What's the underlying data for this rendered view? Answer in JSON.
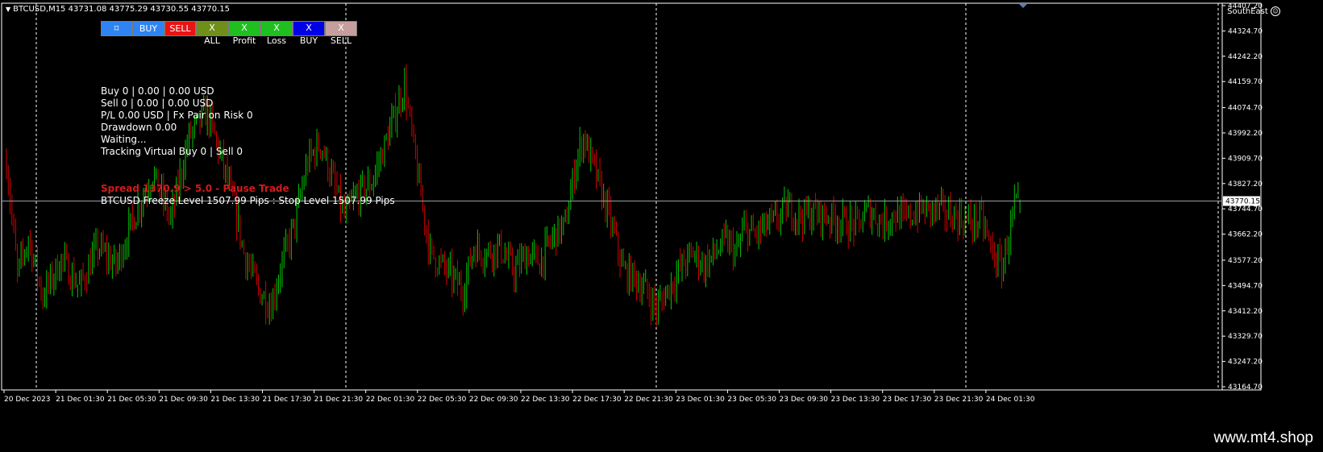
{
  "chart": {
    "symbol_header": "BTCUSD,M15  43731.08 43775.29 43730.55 43770.15",
    "corner_label": "SouthEast",
    "current_price_label": "43770.15",
    "current_price": 43770.15,
    "price_axis": {
      "min": 43164.7,
      "max": 44407.2,
      "labels": [
        "44407.20",
        "44324.70",
        "44242.20",
        "44159.70",
        "44074.70",
        "43992.20",
        "43909.70",
        "43827.20",
        "43744.70",
        "43662.20",
        "43577.20",
        "43494.70",
        "43412.20",
        "43329.70",
        "43247.20",
        "43164.70"
      ]
    },
    "time_axis": {
      "labels": [
        "20 Dec 2023",
        "21 Dec 01:30",
        "21 Dec 05:30",
        "21 Dec 09:30",
        "21 Dec 13:30",
        "21 Dec 17:30",
        "21 Dec 21:30",
        "22 Dec 01:30",
        "22 Dec 05:30",
        "22 Dec 09:30",
        "22 Dec 13:30",
        "22 Dec 17:30",
        "22 Dec 21:30",
        "23 Dec 01:30",
        "23 Dec 05:30",
        "23 Dec 09:30",
        "23 Dec 13:30",
        "23 Dec 17:30",
        "23 Dec 21:30",
        "24 Dec 01:30"
      ]
    },
    "colors": {
      "bull": "#00c800",
      "bear": "#d40000",
      "grid": "#ffffff",
      "price_line": "#9aa0a0"
    }
  },
  "chart_data": {
    "type": "candlestick",
    "symbol": "BTCUSD",
    "timeframe": "M15",
    "last_bar": {
      "open": 43731.08,
      "high": 43775.29,
      "low": 43730.55,
      "close": 43770.15
    },
    "ylim": [
      43164.7,
      44407.2
    ],
    "close_path": [
      [
        0,
        43900
      ],
      [
        6,
        43530
      ],
      [
        12,
        43650
      ],
      [
        20,
        43460
      ],
      [
        30,
        43580
      ],
      [
        40,
        43490
      ],
      [
        50,
        43620
      ],
      [
        60,
        43560
      ],
      [
        70,
        43720
      ],
      [
        80,
        43860
      ],
      [
        90,
        43710
      ],
      [
        100,
        43980
      ],
      [
        110,
        44060
      ],
      [
        118,
        43900
      ],
      [
        125,
        43750
      ],
      [
        130,
        43600
      ],
      [
        138,
        43480
      ],
      [
        145,
        43430
      ],
      [
        150,
        43550
      ],
      [
        158,
        43700
      ],
      [
        165,
        43900
      ],
      [
        172,
        43960
      ],
      [
        178,
        43850
      ],
      [
        185,
        43720
      ],
      [
        192,
        43790
      ],
      [
        200,
        43830
      ],
      [
        210,
        44000
      ],
      [
        218,
        44150
      ],
      [
        224,
        43900
      ],
      [
        232,
        43600
      ],
      [
        240,
        43550
      ],
      [
        250,
        43480
      ],
      [
        256,
        43620
      ],
      [
        262,
        43600
      ],
      [
        270,
        43620
      ],
      [
        278,
        43540
      ],
      [
        285,
        43600
      ],
      [
        292,
        43570
      ],
      [
        300,
        43660
      ],
      [
        306,
        43690
      ],
      [
        312,
        43900
      ],
      [
        316,
        43980
      ],
      [
        322,
        43870
      ],
      [
        330,
        43720
      ],
      [
        338,
        43540
      ],
      [
        344,
        43520
      ],
      [
        350,
        43480
      ],
      [
        356,
        43420
      ],
      [
        362,
        43480
      ],
      [
        370,
        43560
      ],
      [
        376,
        43600
      ],
      [
        382,
        43560
      ],
      [
        388,
        43600
      ],
      [
        394,
        43640
      ],
      [
        400,
        43600
      ],
      [
        404,
        43680
      ],
      [
        410,
        43660
      ],
      [
        416,
        43690
      ],
      [
        420,
        43700
      ],
      [
        428,
        43750
      ],
      [
        434,
        43720
      ],
      [
        442,
        43730
      ],
      [
        450,
        43720
      ],
      [
        458,
        43700
      ],
      [
        466,
        43690
      ],
      [
        472,
        43740
      ],
      [
        480,
        43700
      ],
      [
        486,
        43730
      ],
      [
        492,
        43710
      ],
      [
        500,
        43740
      ],
      [
        510,
        43740
      ],
      [
        520,
        43720
      ],
      [
        528,
        43700
      ],
      [
        534,
        43710
      ],
      [
        540,
        43600
      ],
      [
        545,
        43550
      ],
      [
        548,
        43630
      ],
      [
        552,
        43750
      ],
      [
        555,
        43760
      ]
    ]
  },
  "toolbar": {
    "buttons": [
      {
        "label": "⌑",
        "name": "crosshair-button",
        "bg": "#2f84f2"
      },
      {
        "label": "BUY",
        "name": "buy-button",
        "bg": "#2f84f2"
      },
      {
        "label": "SELL",
        "name": "sell-button",
        "bg": "#e81414"
      },
      {
        "label": "X ALL",
        "name": "close-all-button",
        "bg": "#6f8f19"
      },
      {
        "label": "X Profit",
        "name": "close-profit-button",
        "bg": "#1fbf1f"
      },
      {
        "label": "X Loss",
        "name": "close-loss-button",
        "bg": "#1fbf1f"
      },
      {
        "label": "X BUY",
        "name": "close-buy-button",
        "bg": "#0000e6"
      },
      {
        "label": "X SELL",
        "name": "close-sell-button",
        "bg": "#c69e9e"
      }
    ]
  },
  "info": {
    "lines": [
      "Buy 0 | 0.00 | 0.00 USD",
      "Sell 0 | 0.00 | 0.00 USD",
      "P/L 0.00 USD | Fx Pair on Risk 0",
      "Drawdown 0.00",
      "Waiting...",
      "Tracking Virtual Buy 0 | Sell 0"
    ],
    "spread_line": "Spread 1370.9 > 5.0 - Pause Trade",
    "freeze_line": "BTCUSD Freeze Level  1507.99 Pips : Stop Level 1507.99 Pips"
  },
  "watermark": "www.mt4.shop"
}
